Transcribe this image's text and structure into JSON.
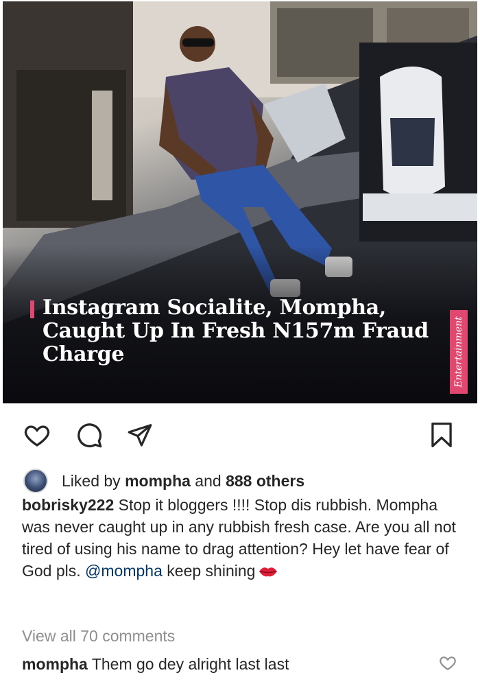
{
  "post": {
    "headline": "Instagram Socialite, Mompha, Caught Up In Fresh N157m Fraud Charge",
    "category": "Entertainment",
    "accent_color": "#e0486f"
  },
  "actions": {
    "like_icon": "heart-icon",
    "comment_icon": "comment-icon",
    "share_icon": "send-icon",
    "save_icon": "bookmark-icon"
  },
  "likes": {
    "prefix": "Liked by",
    "user": "mompha",
    "joiner": "and",
    "others": "888 others"
  },
  "caption": {
    "username": "bobrisky222",
    "text": "Stop it bloggers !!!! Stop dis rubbish. Mompha was never caught up in any rubbish fresh case. Are you all not tired of using his name to drag attention? Hey let have fear of God pls.",
    "mention": "@mompha",
    "tail": "keep shining",
    "emoji": "kiss-lips-emoji"
  },
  "view_comments": "View all 70 comments",
  "comments": [
    {
      "username": "mompha",
      "text": "Them go dey alright last last"
    }
  ]
}
